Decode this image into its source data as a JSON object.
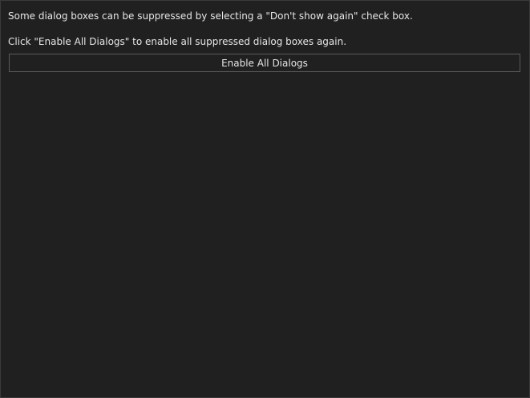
{
  "info": {
    "line1": "Some dialog boxes can be suppressed by selecting a \"Don't show again\" check box.",
    "line2": "Click \"Enable All Dialogs\" to enable all suppressed dialog boxes again."
  },
  "actions": {
    "enable_all_label": "Enable All Dialogs"
  }
}
